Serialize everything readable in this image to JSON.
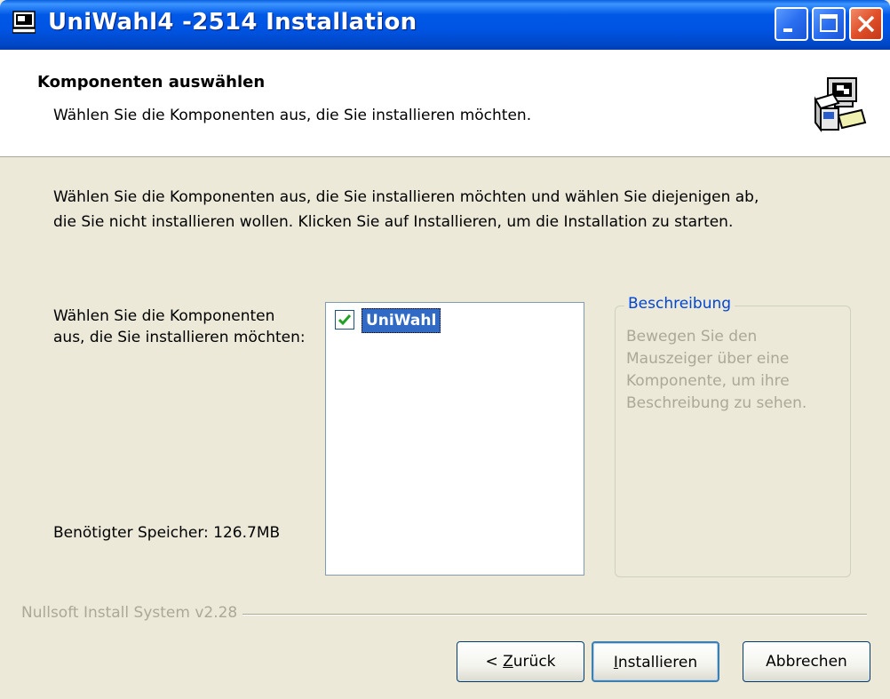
{
  "window": {
    "title": "UniWahl4 -2514 Installation"
  },
  "header": {
    "title": "Komponenten auswählen",
    "subtitle": "Wählen Sie die Komponenten aus, die Sie installieren möchten."
  },
  "body": {
    "intro_line1": "Wählen Sie die Komponenten aus, die Sie installieren möchten und wählen Sie diejenigen ab,",
    "intro_line2": "die Sie nicht installieren wollen. Klicken Sie auf Installieren, um die Installation zu starten.",
    "select_label": "Wählen Sie die Komponenten aus, die Sie installieren möchten:",
    "space_required": "Benötigter Speicher: 126.7MB"
  },
  "components": [
    {
      "label": "UniWahl",
      "checked": true
    }
  ],
  "description": {
    "legend": "Beschreibung",
    "text": "Bewegen Sie den Mauszeiger über eine Komponente, um ihre Beschreibung zu sehen."
  },
  "footer": {
    "branding": "Nullsoft Install System v2.28"
  },
  "buttons": {
    "back_prefix": "< ",
    "back_accel": "Z",
    "back_rest": "urück",
    "install_accel": "I",
    "install_rest": "nstallieren",
    "cancel": "Abbrechen"
  },
  "icons": {
    "title_icon": "installer-window-icon",
    "header_icon": "setup-computer-box-icon"
  },
  "colors": {
    "titlebar": "#0054e3",
    "dialog_bg": "#ece9d8",
    "selection": "#316ac5",
    "legend": "#0046d5",
    "disabled_text": "#aca899"
  }
}
